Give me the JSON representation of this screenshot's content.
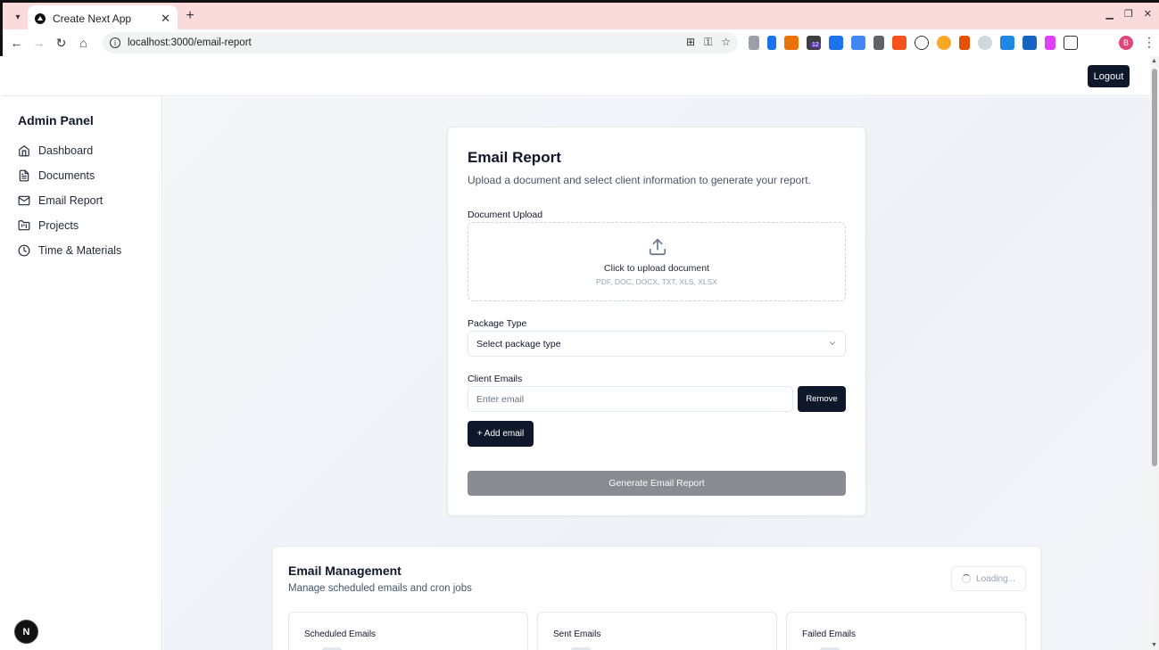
{
  "browser": {
    "tab_title": "Create Next App",
    "url": "localhost:3000/email-report",
    "extension_badge": "12",
    "profile_initial": "B",
    "icons": [
      "tab-list-icon",
      "close-icon",
      "plus-icon",
      "minimize-icon",
      "restore-icon",
      "back-icon",
      "forward-icon",
      "reload-icon",
      "home-icon",
      "info-icon",
      "translate-icon",
      "password-key-icon",
      "star-icon",
      "extensions-icon",
      "menu-icon"
    ]
  },
  "header": {
    "logout_label": "Logout"
  },
  "sidebar": {
    "title": "Admin Panel",
    "items": [
      {
        "label": "Dashboard",
        "icon": "home-icon"
      },
      {
        "label": "Documents",
        "icon": "document-icon"
      },
      {
        "label": "Email Report",
        "icon": "mail-icon"
      },
      {
        "label": "Projects",
        "icon": "folder-kanban-icon"
      },
      {
        "label": "Time & Materials",
        "icon": "clock-icon"
      }
    ]
  },
  "email_report": {
    "title": "Email Report",
    "description": "Upload a document and select client information to generate your report.",
    "upload": {
      "label": "Document Upload",
      "prompt": "Click to upload document",
      "formats": "PDF, DOC, DOCX, TXT, XLS, XLSX"
    },
    "package": {
      "label": "Package Type",
      "selected": "Select package type"
    },
    "emails": {
      "label": "Client Emails",
      "placeholder": "Enter email",
      "remove_label": "Remove",
      "add_label": "+ Add email"
    },
    "generate_label": "Generate Email Report"
  },
  "email_management": {
    "title": "Email Management",
    "description": "Manage scheduled emails and cron jobs",
    "loading_label": "Loading...",
    "stats": [
      {
        "title": "Scheduled Emails"
      },
      {
        "title": "Sent Emails"
      },
      {
        "title": "Failed Emails"
      }
    ]
  },
  "next_badge": "N",
  "colors": {
    "primary": "#0f172a",
    "tabstrip": "#fadadb",
    "disabled_button": "#898c91"
  }
}
